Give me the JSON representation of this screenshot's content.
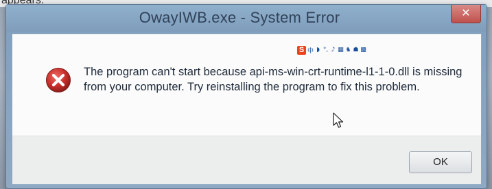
{
  "top_strip": {
    "cut_text": "appears:"
  },
  "window": {
    "title": "OwayIWB.exe - System Error",
    "close_glyph": "✕"
  },
  "ime_toolbar": {
    "logo": "S",
    "glyphs": [
      "中",
      "◗",
      "°,",
      "♪",
      "▦",
      "♞",
      "☗",
      "▩"
    ]
  },
  "dialog": {
    "icon": "error-icon",
    "message": "The program can't start because api-ms-win-crt-runtime-l1-1-0.dll is missing from your computer. Try reinstalling the program to fix this problem.",
    "ok_label": "OK"
  },
  "colors": {
    "error_red": "#c9302c",
    "titlebar": "#8fb0cc",
    "close_button": "#c0504d"
  }
}
